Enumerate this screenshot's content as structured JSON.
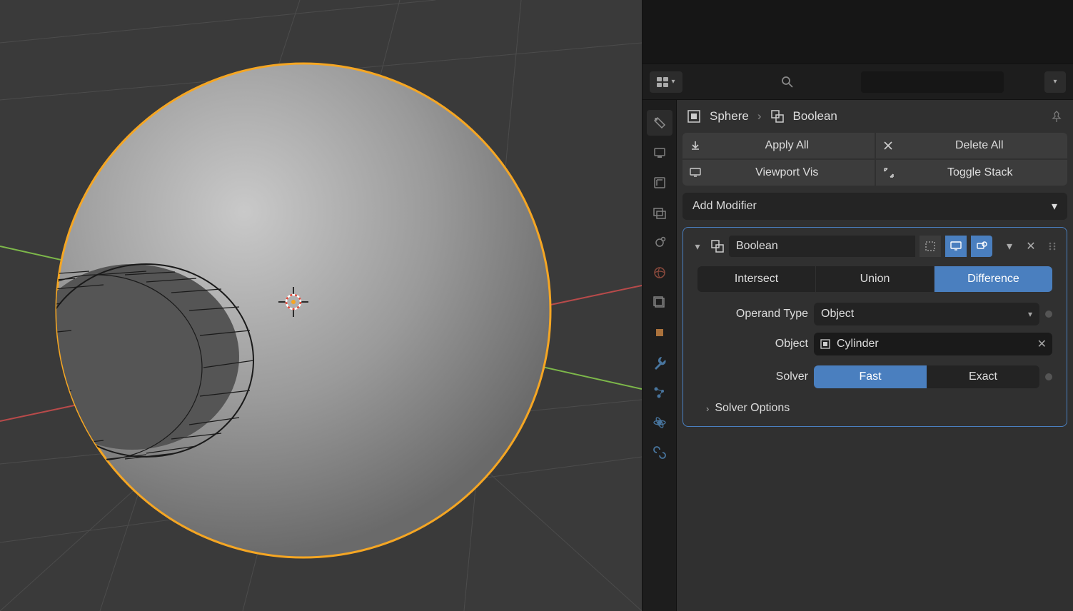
{
  "breadcrumb": {
    "object": "Sphere",
    "modifier": "Boolean"
  },
  "buttons": {
    "apply_all": "Apply All",
    "delete_all": "Delete All",
    "viewport_vis": "Viewport Vis",
    "toggle_stack": "Toggle Stack"
  },
  "add_modifier": "Add Modifier",
  "modifier": {
    "name": "Boolean",
    "operations": {
      "intersect": "Intersect",
      "union": "Union",
      "difference": "Difference",
      "active": "difference"
    },
    "operand_type_label": "Operand Type",
    "operand_type_value": "Object",
    "object_label": "Object",
    "object_value": "Cylinder",
    "solver_label": "Solver",
    "solver": {
      "fast": "Fast",
      "exact": "Exact",
      "active": "fast"
    },
    "solver_options": "Solver Options"
  },
  "search_placeholder": ""
}
